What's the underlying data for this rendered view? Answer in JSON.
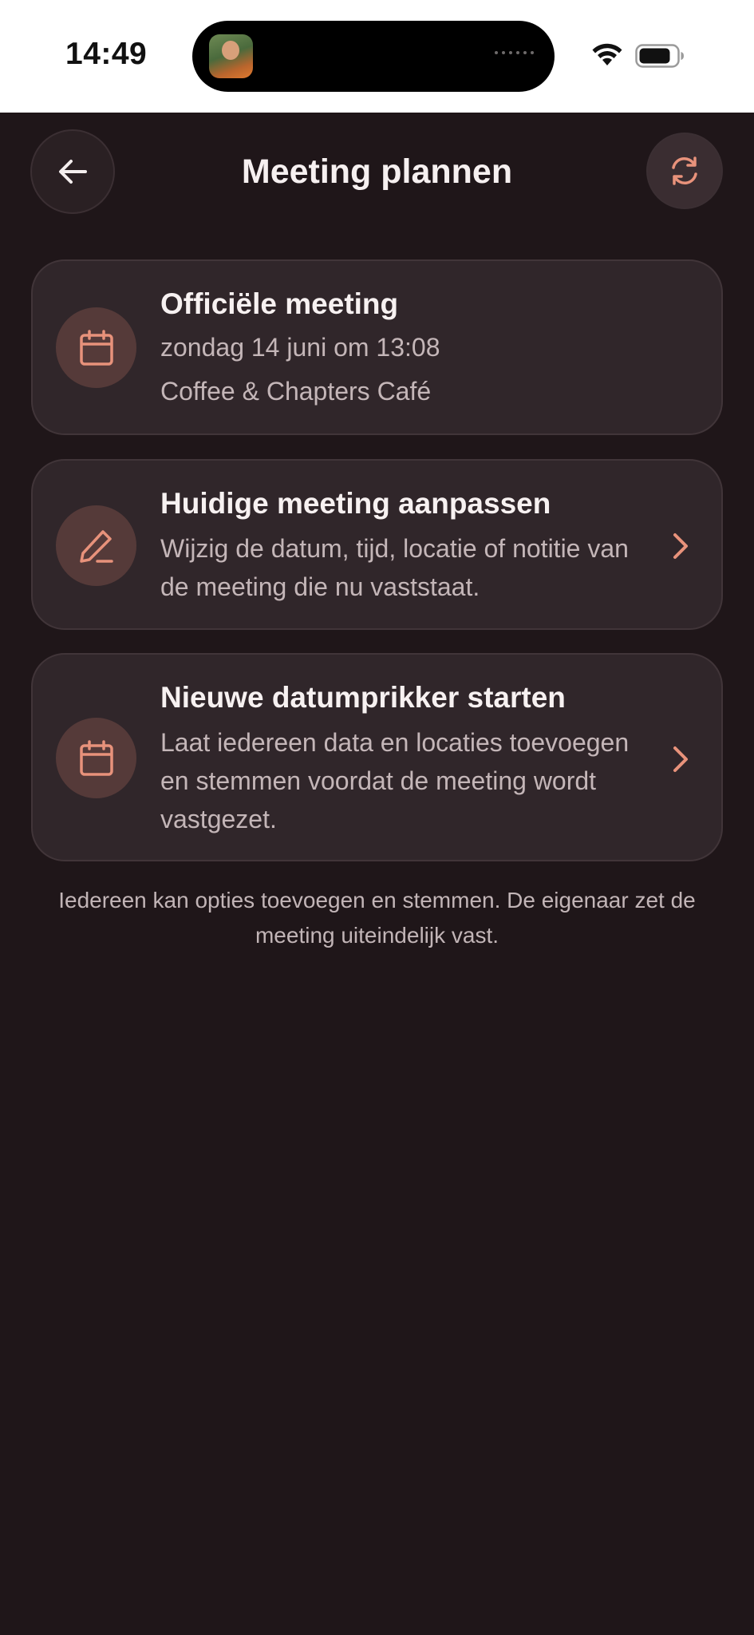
{
  "status_bar": {
    "time": "14:49",
    "icons": [
      "wifi-icon",
      "battery-icon"
    ]
  },
  "header": {
    "title": "Meeting plannen",
    "back_icon": "arrow-left-icon",
    "refresh_icon": "refresh-icon"
  },
  "cards": {
    "official": {
      "icon": "calendar-icon",
      "title": "Officiële meeting",
      "date": "zondag 14 juni om 13:08",
      "location": "Coffee & Chapters Café"
    },
    "edit": {
      "icon": "pencil-icon",
      "title": "Huidige meeting aanpassen",
      "description": "Wijzig de datum, tijd, locatie of notitie van de meeting die nu vaststaat."
    },
    "new_poll": {
      "icon": "calendar-icon",
      "title": "Nieuwe datumprikker starten",
      "description": "Laat iedereen data en locaties toevoegen en stemmen voordat de meeting wordt vastgezet."
    }
  },
  "footer": {
    "note": "Iedereen kan opties toevoegen en stemmen. De eigenaar zet de meeting uiteindelijk vast."
  },
  "colors": {
    "background": "#1f1619",
    "card": "#30262a",
    "accent": "#e8927b",
    "icon_circle": "#553a39"
  }
}
